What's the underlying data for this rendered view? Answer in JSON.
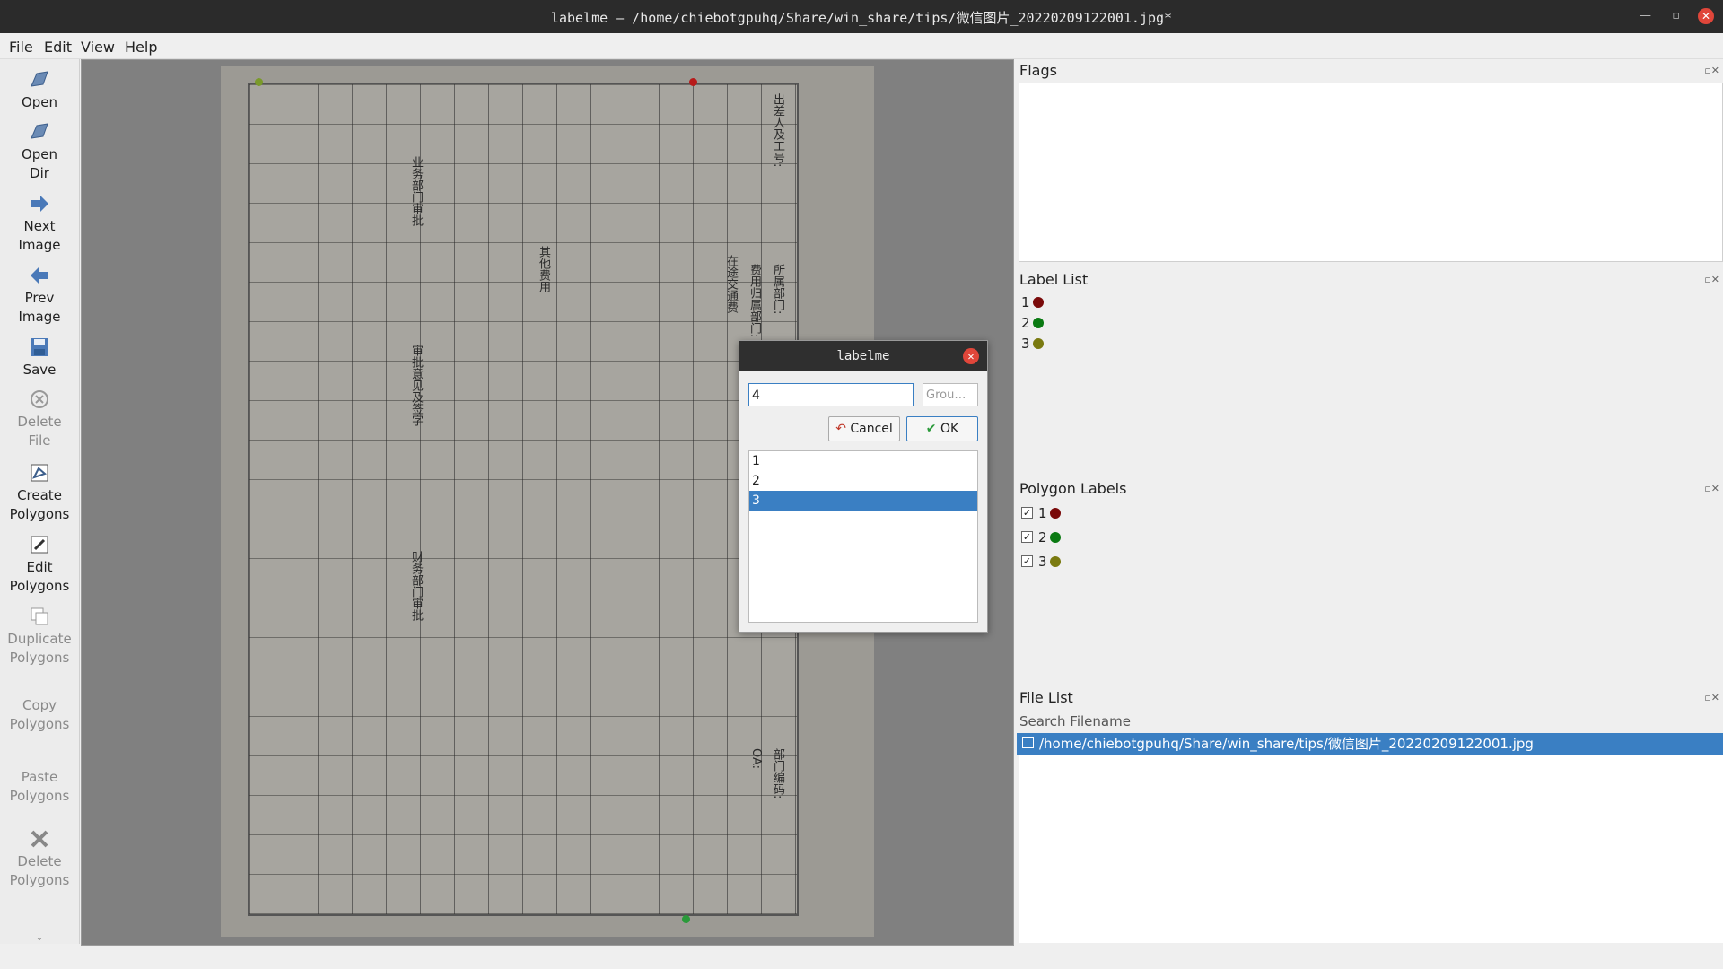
{
  "window": {
    "title": "labelme – /home/chiebotgpuhq/Share/win_share/tips/微信图片_20220209122001.jpg*"
  },
  "menu": [
    "File",
    "Edit",
    "View",
    "Help"
  ],
  "toolbar": [
    {
      "label": "Open",
      "icon": "open-icon",
      "enabled": true
    },
    {
      "label": "Open\nDir",
      "icon": "open-dir-icon",
      "enabled": true
    },
    {
      "label": "Next\nImage",
      "icon": "next-image-icon",
      "enabled": true
    },
    {
      "label": "Prev\nImage",
      "icon": "prev-image-icon",
      "enabled": true
    },
    {
      "label": "Save",
      "icon": "save-icon",
      "enabled": true
    },
    {
      "label": "Delete\nFile",
      "icon": "delete-file-icon",
      "enabled": false
    },
    {
      "label": "Create\nPolygons",
      "icon": "create-polygons-icon",
      "enabled": true
    },
    {
      "label": "Edit\nPolygons",
      "icon": "edit-polygons-icon",
      "enabled": true
    },
    {
      "label": "Duplicate\nPolygons",
      "icon": "duplicate-polygons-icon",
      "enabled": false
    },
    {
      "label": "Copy\nPolygons",
      "icon": "copy-polygons-icon",
      "enabled": false
    },
    {
      "label": "Paste\nPolygons",
      "icon": "paste-polygons-icon",
      "enabled": false
    },
    {
      "label": "Delete\nPolygons",
      "icon": "delete-polygons-icon",
      "enabled": false
    }
  ],
  "docks": {
    "flags": {
      "title": "Flags"
    },
    "label_list": {
      "title": "Label List",
      "items": [
        {
          "label": "1",
          "color": "#7a0a0a"
        },
        {
          "label": "2",
          "color": "#0a7a12"
        },
        {
          "label": "3",
          "color": "#7a7a10"
        }
      ]
    },
    "polygon_labels": {
      "title": "Polygon Labels",
      "items": [
        {
          "label": "1",
          "color": "#7a0a0a",
          "checked": true
        },
        {
          "label": "2",
          "color": "#0a7a12",
          "checked": true
        },
        {
          "label": "3",
          "color": "#7a7a10",
          "checked": true
        }
      ]
    },
    "file_list": {
      "title": "File List",
      "search_placeholder": "Search Filename",
      "files": [
        "/home/chiebotgpuhq/Share/win_share/tips/微信图片_20220209122001.jpg"
      ]
    }
  },
  "dialog": {
    "title": "labelme",
    "label_value": "4",
    "group_placeholder": "Grou…",
    "cancel_label": "Cancel",
    "ok_label": "OK",
    "labels": [
      "1",
      "2",
      "3"
    ],
    "selected": "3"
  },
  "paper_texts": [
    "出差人及工号:",
    "所属部门:",
    "费用归属部门:",
    "在途交通费",
    "其他费用",
    "业务部门审批",
    "财务部门审批",
    "审批意见及签字",
    "部门编码:",
    "OA:"
  ],
  "colors": {
    "accent": "#3a7fc3",
    "close": "#e0463a"
  }
}
